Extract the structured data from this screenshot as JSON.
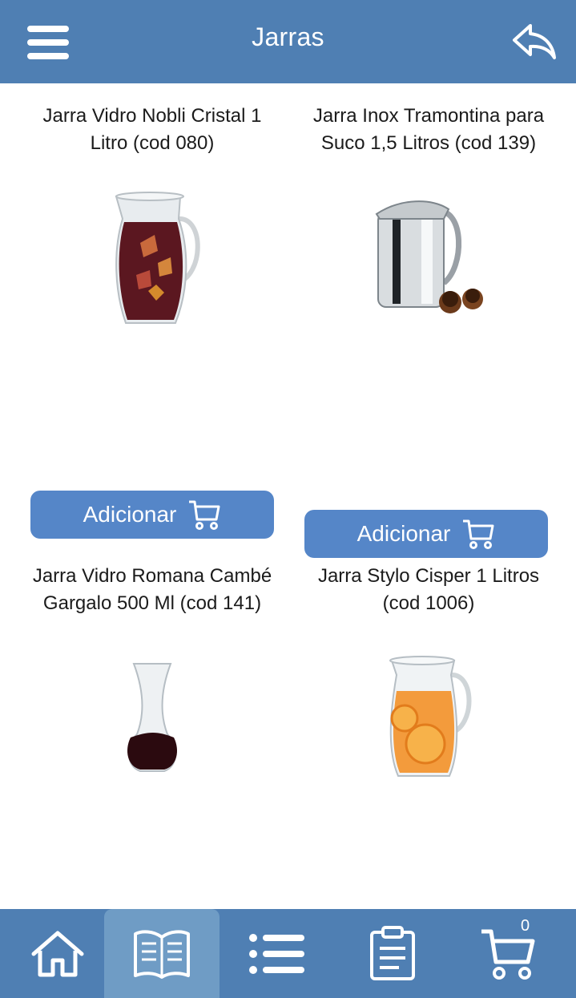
{
  "header": {
    "title": "Jarras",
    "menu_icon": "hamburger-menu-icon",
    "back_icon": "reply-back-icon"
  },
  "products": [
    {
      "name": "Jarra Vidro Nobli Cristal 1 Litro (cod 080)",
      "button_label": "Adicionar",
      "image": "glass-pitcher-sangria"
    },
    {
      "name": "Jarra Inox Tramontina para Suco 1,5 Litros (cod 139)",
      "button_label": "Adicionar",
      "image": "stainless-steel-pitcher"
    },
    {
      "name": "Jarra Vidro Romana Cambé Gargalo 500 Ml (cod 141)",
      "button_label": "",
      "image": "glass-carafe-wine"
    },
    {
      "name": "Jarra Stylo Cisper 1 Litros (cod 1006)",
      "button_label": "",
      "image": "glass-pitcher-orange-juice"
    }
  ],
  "bottom_nav": {
    "items": [
      {
        "icon": "home-icon",
        "active": false
      },
      {
        "icon": "catalog-book-icon",
        "active": true
      },
      {
        "icon": "list-icon",
        "active": false
      },
      {
        "icon": "clipboard-icon",
        "active": false
      },
      {
        "icon": "cart-icon",
        "active": false
      }
    ],
    "cart_count": "0"
  },
  "colors": {
    "header_bg": "#4f7fb3",
    "button_bg": "#5586c8",
    "nav_active_bg": "#6f9cc5",
    "text": "#1b1b1b"
  }
}
